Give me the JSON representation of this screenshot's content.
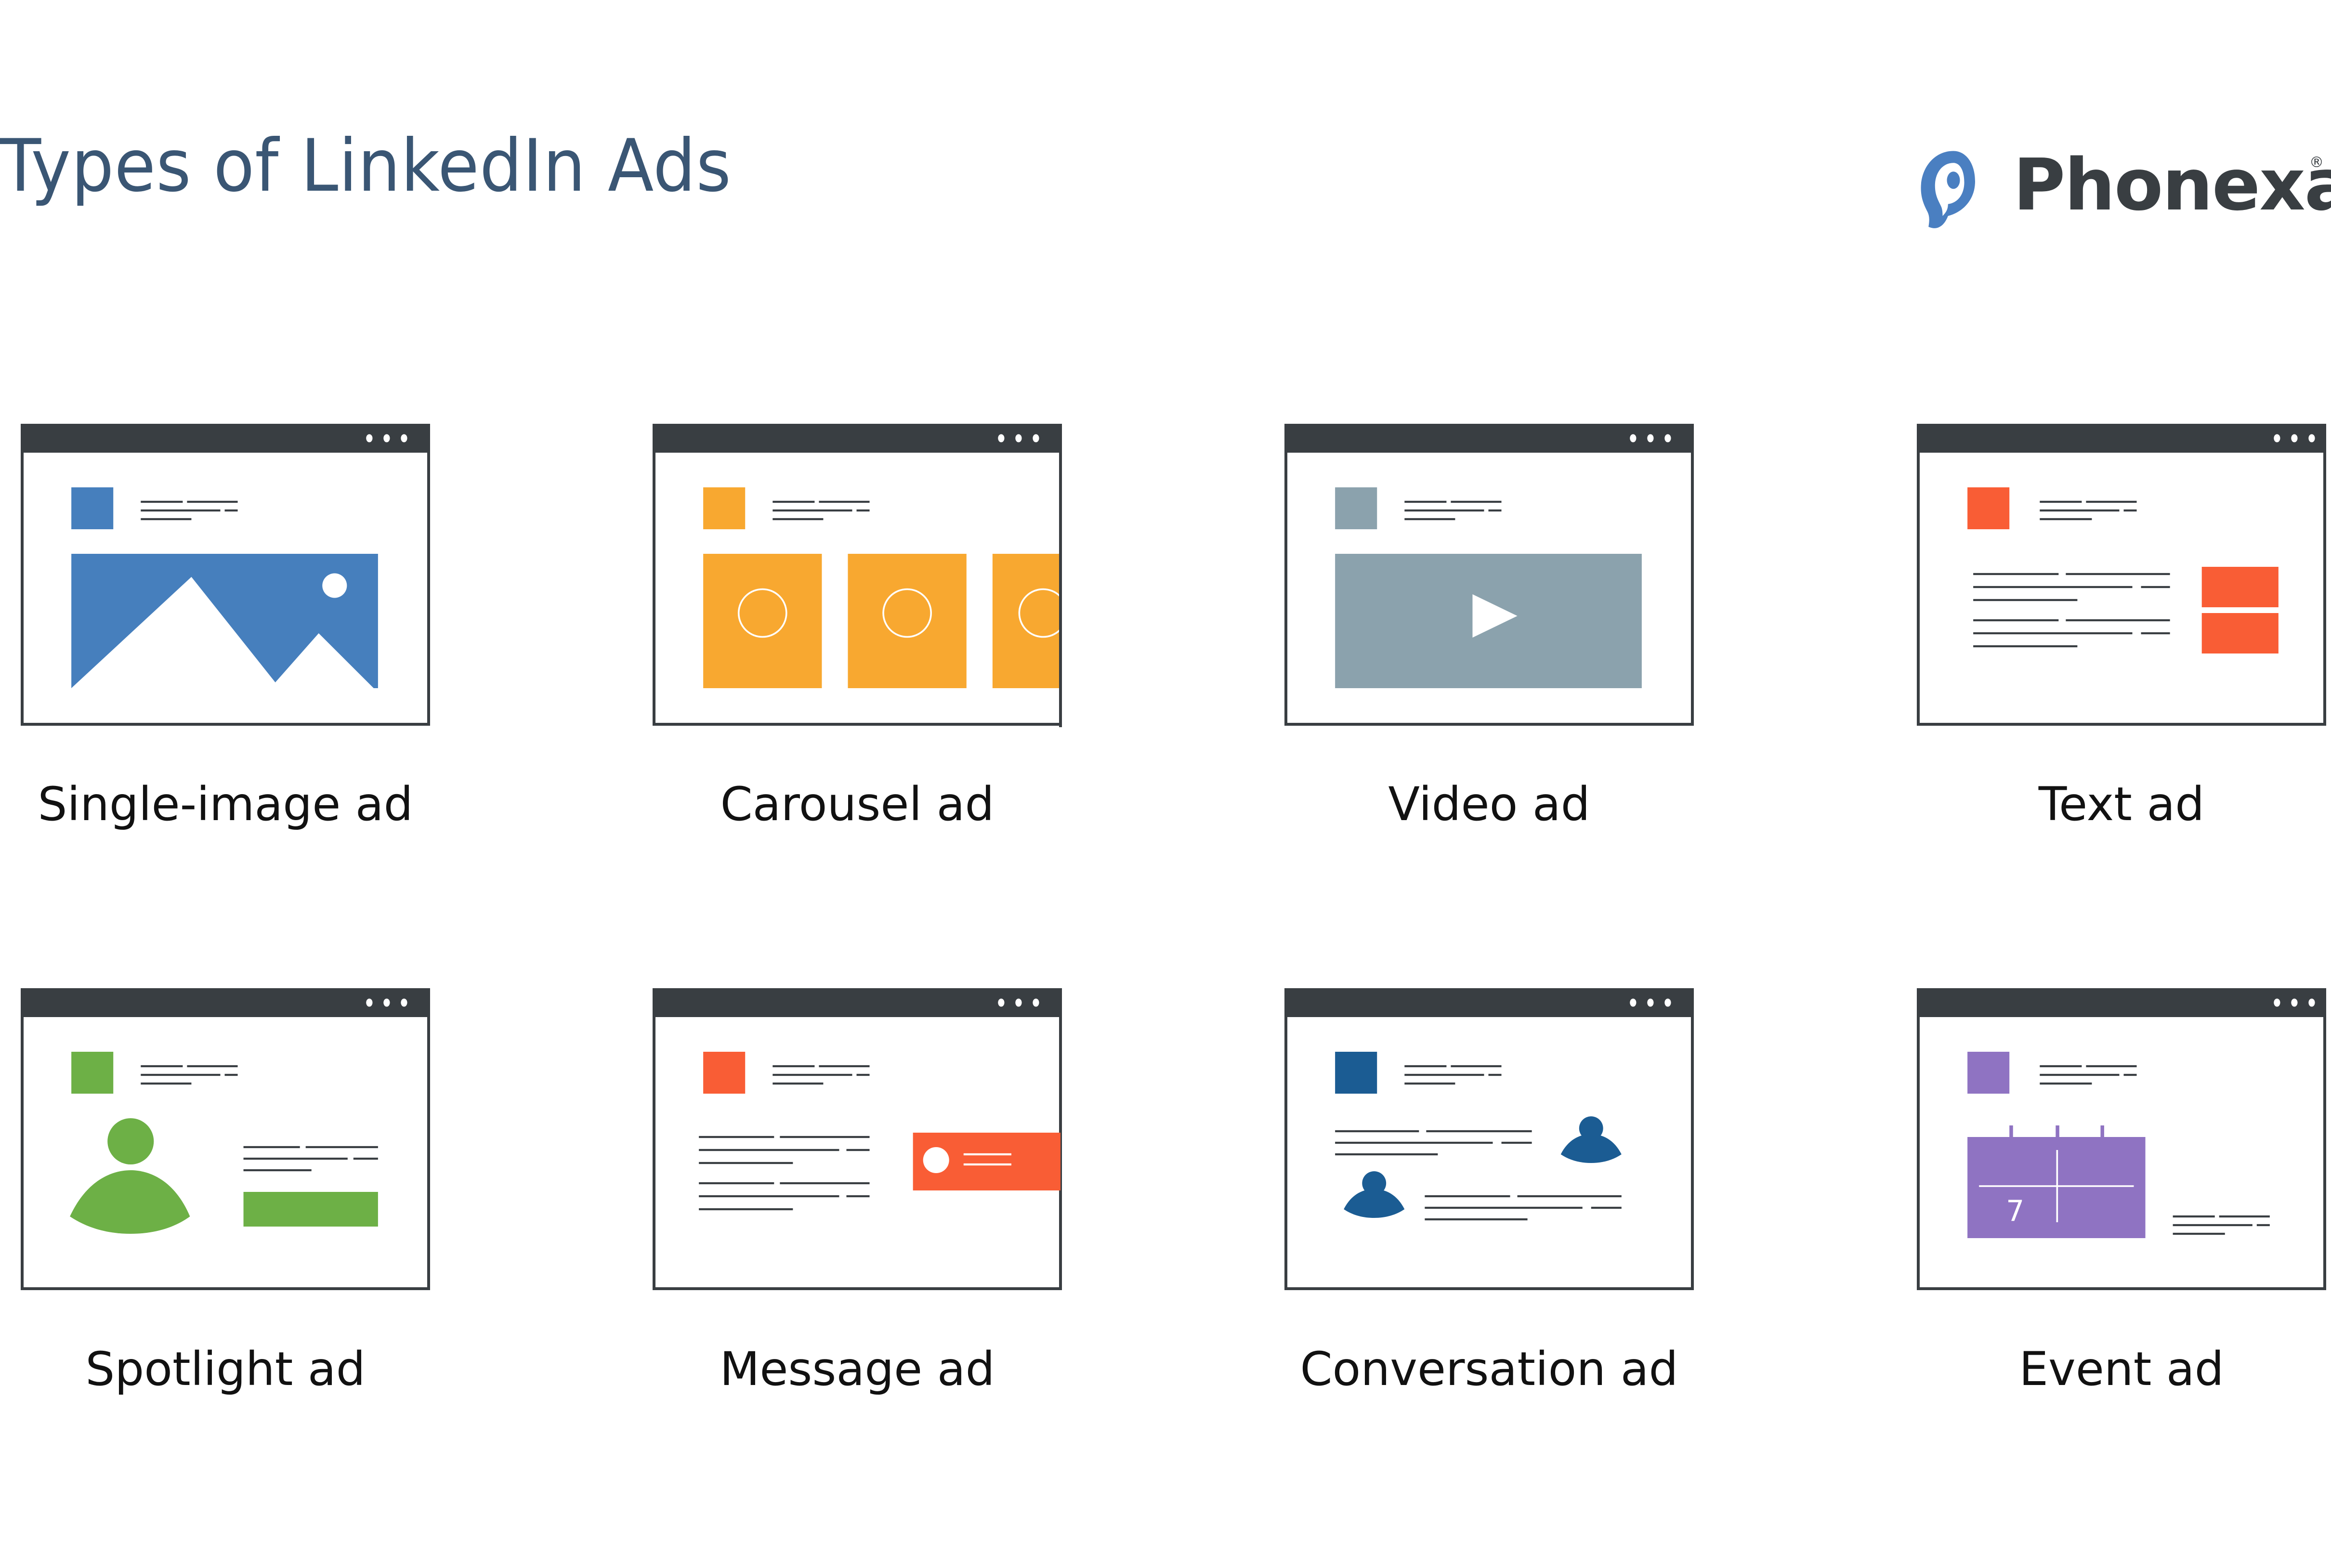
{
  "header": {
    "title": "Types of LinkedIn Ads"
  },
  "brand": {
    "name": "Phonexa",
    "registered_mark": "®",
    "logo_icon": "speech-bubble-p-icon",
    "color": "#4a7fc1",
    "text_color": "#393e42"
  },
  "colors": {
    "window_bar": "#393e42",
    "single_image": "#467fbd",
    "carousel": "#f8a830",
    "video": "#8ba2ad",
    "text": "#f95d35",
    "spotlight": "#6db046",
    "message": "#f95d35",
    "conversation": "#1b5c93",
    "event": "#8f73c2"
  },
  "ad_types": [
    {
      "label": "Single-image ad",
      "icon": "mountain-image-icon"
    },
    {
      "label": "Carousel ad",
      "icon": "carousel-cards-icon"
    },
    {
      "label": "Video ad",
      "icon": "play-icon"
    },
    {
      "label": "Text ad",
      "icon": "text-lines-icon"
    },
    {
      "label": "Spotlight ad",
      "icon": "person-icon"
    },
    {
      "label": "Message ad",
      "icon": "message-bubble-icon"
    },
    {
      "label": "Conversation ad",
      "icon": "two-people-icon"
    },
    {
      "label": "Event ad",
      "icon": "calendar-icon"
    }
  ],
  "event_calendar_day": "7"
}
